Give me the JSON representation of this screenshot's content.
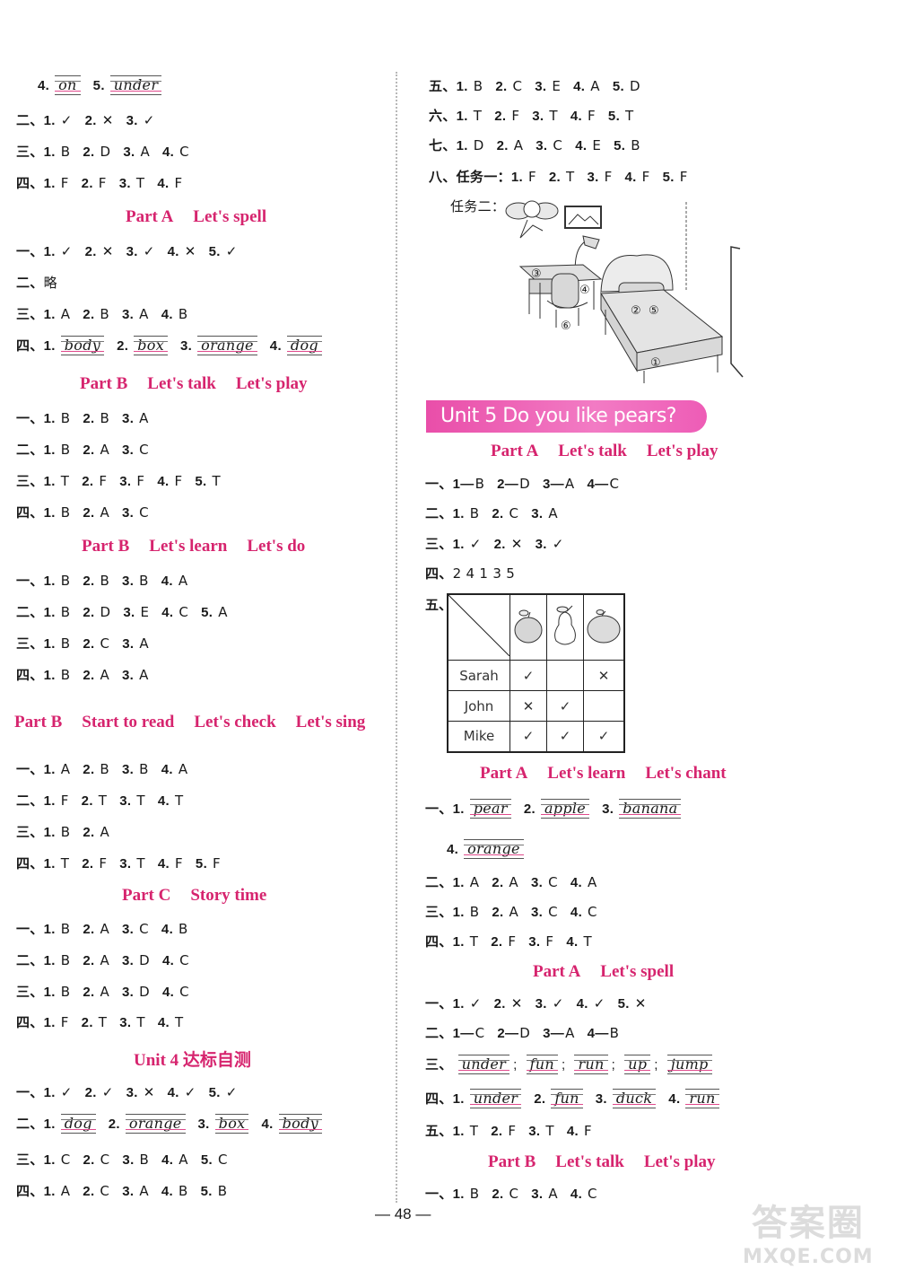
{
  "left": {
    "row_top_4": {
      "items": [
        {
          "n": "4.",
          "w": "on"
        },
        {
          "n": "5.",
          "w": "under"
        }
      ]
    },
    "r1": {
      "prefix": "二、",
      "items": [
        {
          "n": "1.",
          "a": "✓"
        },
        {
          "n": "2.",
          "a": "✕"
        },
        {
          "n": "3.",
          "a": "✓"
        }
      ]
    },
    "r2": {
      "prefix": "三、",
      "items": [
        {
          "n": "1.",
          "a": "B"
        },
        {
          "n": "2.",
          "a": "D"
        },
        {
          "n": "3.",
          "a": "A"
        },
        {
          "n": "4.",
          "a": "C"
        }
      ]
    },
    "r3": {
      "prefix": "四、",
      "items": [
        {
          "n": "1.",
          "a": "F"
        },
        {
          "n": "2.",
          "a": "F"
        },
        {
          "n": "3.",
          "a": "T"
        },
        {
          "n": "4.",
          "a": "F"
        }
      ]
    },
    "h1": {
      "part": "Part A",
      "titles": [
        "Let's spell"
      ]
    },
    "r4": {
      "prefix": "一、",
      "items": [
        {
          "n": "1.",
          "a": "✓"
        },
        {
          "n": "2.",
          "a": "✕"
        },
        {
          "n": "3.",
          "a": "✓"
        },
        {
          "n": "4.",
          "a": "✕"
        },
        {
          "n": "5.",
          "a": "✓"
        }
      ]
    },
    "r5": {
      "prefix": "二、",
      "text": "略"
    },
    "r6": {
      "prefix": "三、",
      "items": [
        {
          "n": "1.",
          "a": "A"
        },
        {
          "n": "2.",
          "a": "B"
        },
        {
          "n": "3.",
          "a": "A"
        },
        {
          "n": "4.",
          "a": "B"
        }
      ]
    },
    "r7": {
      "prefix": "四、",
      "items": [
        {
          "n": "1.",
          "w": "body"
        },
        {
          "n": "2.",
          "w": "box"
        },
        {
          "n": "3.",
          "w": "orange"
        },
        {
          "n": "4.",
          "w": "dog"
        }
      ]
    },
    "h2": {
      "part": "Part B",
      "titles": [
        "Let's talk",
        "Let's play"
      ]
    },
    "r8": {
      "prefix": "一、",
      "items": [
        {
          "n": "1.",
          "a": "B"
        },
        {
          "n": "2.",
          "a": "B"
        },
        {
          "n": "3.",
          "a": "A"
        }
      ]
    },
    "r9": {
      "prefix": "二、",
      "items": [
        {
          "n": "1.",
          "a": "B"
        },
        {
          "n": "2.",
          "a": "A"
        },
        {
          "n": "3.",
          "a": "C"
        }
      ]
    },
    "r10": {
      "prefix": "三、",
      "items": [
        {
          "n": "1.",
          "a": "T"
        },
        {
          "n": "2.",
          "a": "F"
        },
        {
          "n": "3.",
          "a": "F"
        },
        {
          "n": "4.",
          "a": "F"
        },
        {
          "n": "5.",
          "a": "T"
        }
      ]
    },
    "r11": {
      "prefix": "四、",
      "items": [
        {
          "n": "1.",
          "a": "B"
        },
        {
          "n": "2.",
          "a": "A"
        },
        {
          "n": "3.",
          "a": "C"
        }
      ]
    },
    "h3": {
      "part": "Part B",
      "titles": [
        "Let's learn",
        "Let's do"
      ]
    },
    "r12": {
      "prefix": "一、",
      "items": [
        {
          "n": "1.",
          "a": "B"
        },
        {
          "n": "2.",
          "a": "B"
        },
        {
          "n": "3.",
          "a": "B"
        },
        {
          "n": "4.",
          "a": "A"
        }
      ]
    },
    "r13": {
      "prefix": "二、",
      "items": [
        {
          "n": "1.",
          "a": "B"
        },
        {
          "n": "2.",
          "a": "D"
        },
        {
          "n": "3.",
          "a": "E"
        },
        {
          "n": "4.",
          "a": "C"
        },
        {
          "n": "5.",
          "a": "A"
        }
      ]
    },
    "r14": {
      "prefix": "三、",
      "items": [
        {
          "n": "1.",
          "a": "B"
        },
        {
          "n": "2.",
          "a": "C"
        },
        {
          "n": "3.",
          "a": "A"
        }
      ]
    },
    "r15": {
      "prefix": "四、",
      "items": [
        {
          "n": "1.",
          "a": "B"
        },
        {
          "n": "2.",
          "a": "A"
        },
        {
          "n": "3.",
          "a": "A"
        }
      ]
    },
    "h4": {
      "part": "Part B",
      "titles": [
        "Start to read",
        "Let's check",
        "Let's sing"
      ]
    },
    "r16": {
      "prefix": "一、",
      "items": [
        {
          "n": "1.",
          "a": "A"
        },
        {
          "n": "2.",
          "a": "B"
        },
        {
          "n": "3.",
          "a": "B"
        },
        {
          "n": "4.",
          "a": "A"
        }
      ]
    },
    "r17": {
      "prefix": "二、",
      "items": [
        {
          "n": "1.",
          "a": "F"
        },
        {
          "n": "2.",
          "a": "T"
        },
        {
          "n": "3.",
          "a": "T"
        },
        {
          "n": "4.",
          "a": "T"
        }
      ]
    },
    "r18": {
      "prefix": "三、",
      "items": [
        {
          "n": "1.",
          "a": "B"
        },
        {
          "n": "2.",
          "a": "A"
        }
      ]
    },
    "r19": {
      "prefix": "四、",
      "items": [
        {
          "n": "1.",
          "a": "T"
        },
        {
          "n": "2.",
          "a": "F"
        },
        {
          "n": "3.",
          "a": "T"
        },
        {
          "n": "4.",
          "a": "F"
        },
        {
          "n": "5.",
          "a": "F"
        }
      ]
    },
    "h5": {
      "part": "Part C",
      "titles": [
        "Story time"
      ]
    },
    "r20": {
      "prefix": "一、",
      "items": [
        {
          "n": "1.",
          "a": "B"
        },
        {
          "n": "2.",
          "a": "A"
        },
        {
          "n": "3.",
          "a": "C"
        },
        {
          "n": "4.",
          "a": "B"
        }
      ]
    },
    "r21": {
      "prefix": "二、",
      "items": [
        {
          "n": "1.",
          "a": "B"
        },
        {
          "n": "2.",
          "a": "A"
        },
        {
          "n": "3.",
          "a": "D"
        },
        {
          "n": "4.",
          "a": "C"
        }
      ]
    },
    "r22": {
      "prefix": "三、",
      "items": [
        {
          "n": "1.",
          "a": "B"
        },
        {
          "n": "2.",
          "a": "A"
        },
        {
          "n": "3.",
          "a": "D"
        },
        {
          "n": "4.",
          "a": "C"
        }
      ]
    },
    "r23": {
      "prefix": "四、",
      "items": [
        {
          "n": "1.",
          "a": "F"
        },
        {
          "n": "2.",
          "a": "T"
        },
        {
          "n": "3.",
          "a": "T"
        },
        {
          "n": "4.",
          "a": "T"
        }
      ]
    },
    "h6": {
      "part": "Unit 4 达标自测",
      "titles": []
    },
    "r24": {
      "prefix": "一、",
      "items": [
        {
          "n": "1.",
          "a": "✓"
        },
        {
          "n": "2.",
          "a": "✓"
        },
        {
          "n": "3.",
          "a": "✕"
        },
        {
          "n": "4.",
          "a": "✓"
        },
        {
          "n": "5.",
          "a": "✓"
        }
      ]
    },
    "r25": {
      "prefix": "二、",
      "items": [
        {
          "n": "1.",
          "w": "dog"
        },
        {
          "n": "2.",
          "w": "orange"
        },
        {
          "n": "3.",
          "w": "box"
        },
        {
          "n": "4.",
          "w": "body"
        }
      ]
    },
    "r26": {
      "prefix": "三、",
      "items": [
        {
          "n": "1.",
          "a": "C"
        },
        {
          "n": "2.",
          "a": "C"
        },
        {
          "n": "3.",
          "a": "B"
        },
        {
          "n": "4.",
          "a": "A"
        },
        {
          "n": "5.",
          "a": "C"
        }
      ]
    },
    "r27": {
      "prefix": "四、",
      "items": [
        {
          "n": "1.",
          "a": "A"
        },
        {
          "n": "2.",
          "a": "C"
        },
        {
          "n": "3.",
          "a": "A"
        },
        {
          "n": "4.",
          "a": "B"
        },
        {
          "n": "5.",
          "a": "B"
        }
      ]
    }
  },
  "right": {
    "r1": {
      "prefix": "五、",
      "items": [
        {
          "n": "1.",
          "a": "B"
        },
        {
          "n": "2.",
          "a": "C"
        },
        {
          "n": "3.",
          "a": "E"
        },
        {
          "n": "4.",
          "a": "A"
        },
        {
          "n": "5.",
          "a": "D"
        }
      ]
    },
    "r2": {
      "prefix": "六、",
      "items": [
        {
          "n": "1.",
          "a": "T"
        },
        {
          "n": "2.",
          "a": "F"
        },
        {
          "n": "3.",
          "a": "T"
        },
        {
          "n": "4.",
          "a": "F"
        },
        {
          "n": "5.",
          "a": "T"
        }
      ]
    },
    "r3": {
      "prefix": "七、",
      "items": [
        {
          "n": "1.",
          "a": "D"
        },
        {
          "n": "2.",
          "a": "A"
        },
        {
          "n": "3.",
          "a": "C"
        },
        {
          "n": "4.",
          "a": "E"
        },
        {
          "n": "5.",
          "a": "B"
        }
      ]
    },
    "r4": {
      "prefix": "八、任务一：",
      "items": [
        {
          "n": "1.",
          "a": "F"
        },
        {
          "n": "2.",
          "a": "T"
        },
        {
          "n": "3.",
          "a": "F"
        },
        {
          "n": "4.",
          "a": "F"
        },
        {
          "n": "5.",
          "a": "F"
        }
      ]
    },
    "task2_label": "任务二：",
    "picture_markers": [
      "①",
      "②",
      "③",
      "④",
      "⑤",
      "⑥"
    ],
    "banner": "Unit 5   Do you like pears?",
    "h1": {
      "part": "Part A",
      "titles": [
        "Let's talk",
        "Let's play"
      ]
    },
    "r5": {
      "prefix": "一、",
      "items": [
        {
          "n": "1—",
          "a": "B"
        },
        {
          "n": "2—",
          "a": "D"
        },
        {
          "n": "3—",
          "a": "A"
        },
        {
          "n": "4—",
          "a": "C"
        }
      ]
    },
    "r6": {
      "prefix": "二、",
      "items": [
        {
          "n": "1.",
          "a": "B"
        },
        {
          "n": "2.",
          "a": "C"
        },
        {
          "n": "3.",
          "a": "A"
        }
      ]
    },
    "r7": {
      "prefix": "三、",
      "items": [
        {
          "n": "1.",
          "a": "✓"
        },
        {
          "n": "2.",
          "a": "✕"
        },
        {
          "n": "3.",
          "a": "✓"
        }
      ]
    },
    "r8": {
      "prefix": "四、",
      "text": "2  4  1  3  5"
    },
    "table": {
      "label": "五、",
      "columns": [
        "apple",
        "pear",
        "orange"
      ],
      "rows": [
        {
          "name": "Sarah",
          "marks": [
            "✓",
            "",
            "✕"
          ]
        },
        {
          "name": "John",
          "marks": [
            "✕",
            "✓",
            ""
          ]
        },
        {
          "name": "Mike",
          "marks": [
            "✓",
            "✓",
            "✓"
          ]
        }
      ]
    },
    "h2": {
      "part": "Part A",
      "titles": [
        "Let's learn",
        "Let's chant"
      ]
    },
    "r9": {
      "prefix": "一、",
      "items": [
        {
          "n": "1.",
          "w": "pear"
        },
        {
          "n": "2.",
          "w": "apple"
        },
        {
          "n": "3.",
          "w": "banana"
        }
      ]
    },
    "r10": {
      "prefix": "",
      "items": [
        {
          "n": "4.",
          "w": "orange"
        }
      ]
    },
    "r11": {
      "prefix": "二、",
      "items": [
        {
          "n": "1.",
          "a": "A"
        },
        {
          "n": "2.",
          "a": "A"
        },
        {
          "n": "3.",
          "a": "C"
        },
        {
          "n": "4.",
          "a": "A"
        }
      ]
    },
    "r12": {
      "prefix": "三、",
      "items": [
        {
          "n": "1.",
          "a": "B"
        },
        {
          "n": "2.",
          "a": "A"
        },
        {
          "n": "3.",
          "a": "C"
        },
        {
          "n": "4.",
          "a": "C"
        }
      ]
    },
    "r13": {
      "prefix": "四、",
      "items": [
        {
          "n": "1.",
          "a": "T"
        },
        {
          "n": "2.",
          "a": "F"
        },
        {
          "n": "3.",
          "a": "F"
        },
        {
          "n": "4.",
          "a": "T"
        }
      ]
    },
    "h3": {
      "part": "Part A",
      "titles": [
        "Let's spell"
      ]
    },
    "r14": {
      "prefix": "一、",
      "items": [
        {
          "n": "1.",
          "a": "✓"
        },
        {
          "n": "2.",
          "a": "✕"
        },
        {
          "n": "3.",
          "a": "✓"
        },
        {
          "n": "4.",
          "a": "✓"
        },
        {
          "n": "5.",
          "a": "✕"
        }
      ]
    },
    "r15": {
      "prefix": "二、",
      "items": [
        {
          "n": "1—",
          "a": "C"
        },
        {
          "n": "2—",
          "a": "D"
        },
        {
          "n": "3—",
          "a": "A"
        },
        {
          "n": "4—",
          "a": "B"
        }
      ]
    },
    "r16": {
      "prefix": "三、",
      "words": [
        "under",
        "fun",
        "run",
        "up",
        "jump"
      ]
    },
    "r17": {
      "prefix": "四、",
      "items": [
        {
          "n": "1.",
          "w": "under"
        },
        {
          "n": "2.",
          "w": "fun"
        },
        {
          "n": "3.",
          "w": "duck"
        },
        {
          "n": "4.",
          "w": "run"
        }
      ]
    },
    "r18": {
      "prefix": "五、",
      "items": [
        {
          "n": "1.",
          "a": "T"
        },
        {
          "n": "2.",
          "a": "F"
        },
        {
          "n": "3.",
          "a": "T"
        },
        {
          "n": "4.",
          "a": "F"
        }
      ]
    },
    "h4": {
      "part": "Part B",
      "titles": [
        "Let's talk",
        "Let's play"
      ]
    },
    "r19": {
      "prefix": "一、",
      "items": [
        {
          "n": "1.",
          "a": "B"
        },
        {
          "n": "2.",
          "a": "C"
        },
        {
          "n": "3.",
          "a": "A"
        },
        {
          "n": "4.",
          "a": "C"
        }
      ]
    }
  },
  "page_number": "— 48 —",
  "watermark": {
    "line1": "答案圈",
    "line2": "MXQE.COM"
  },
  "colors": {
    "heading": "#d6246e",
    "banner": "#e94ea9",
    "handwriting_line": "#e04a8c"
  }
}
